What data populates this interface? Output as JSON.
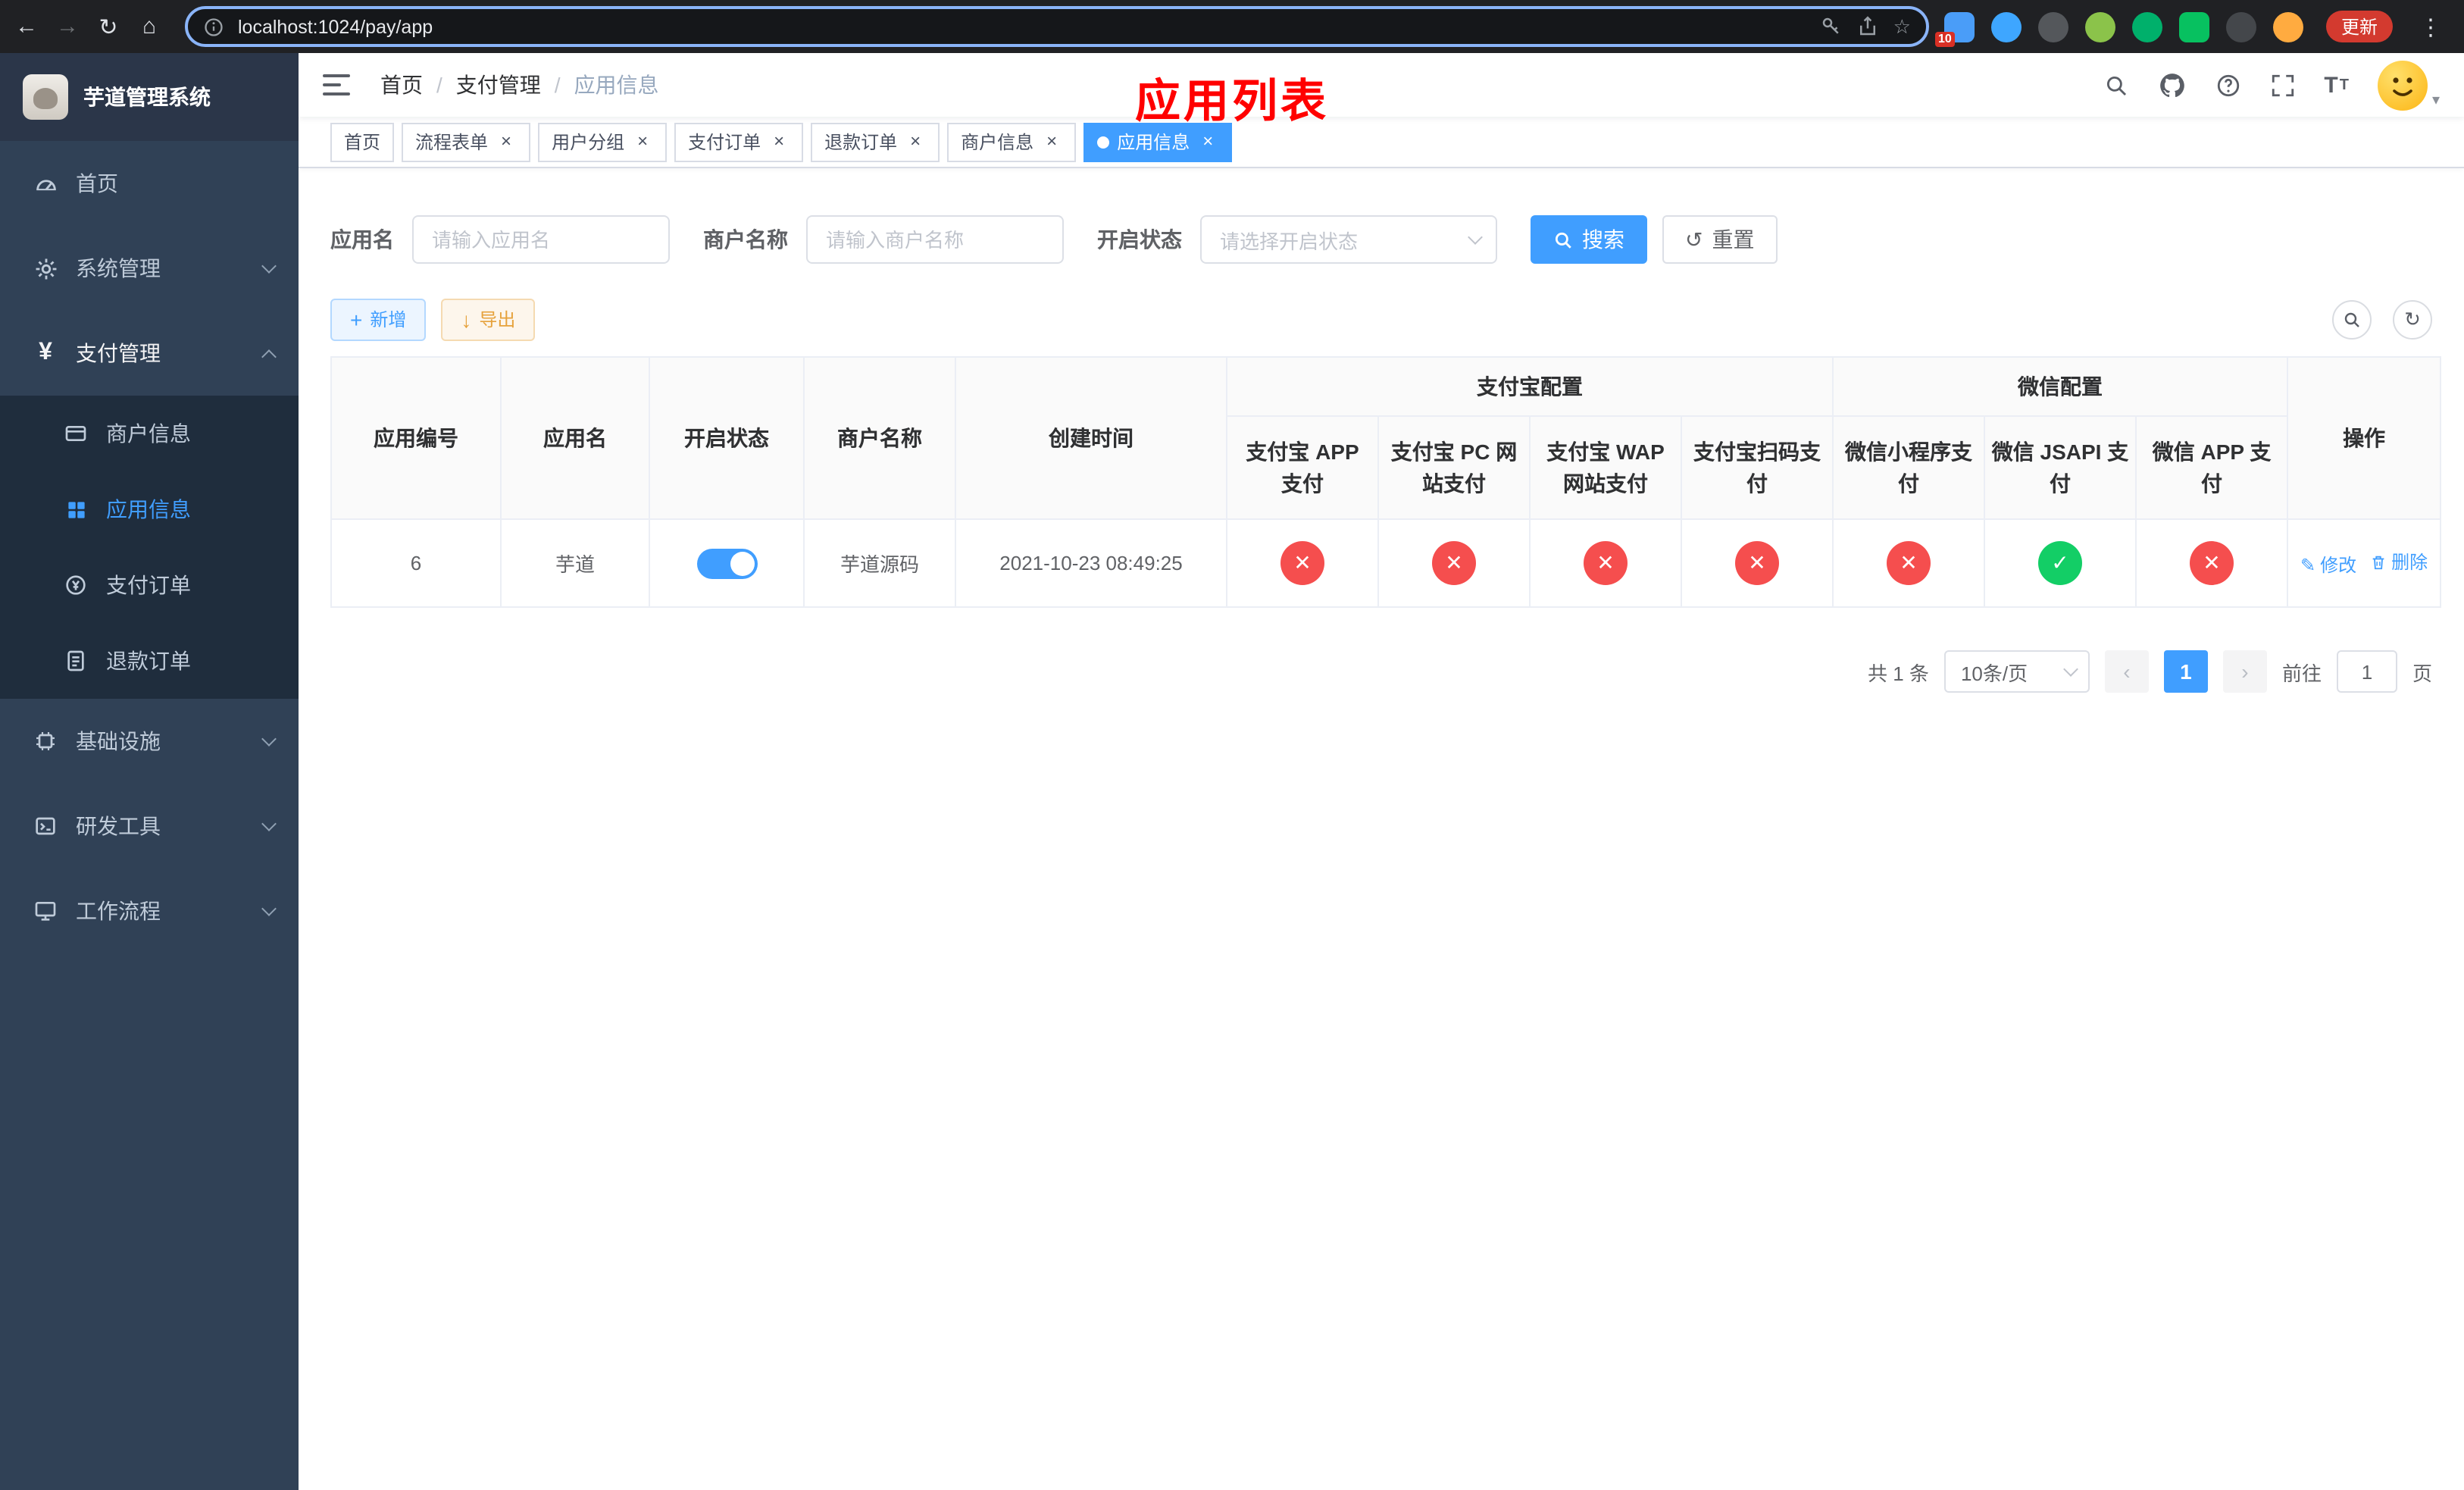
{
  "browser": {
    "url": "localhost:1024/pay/app",
    "update_label": "更新",
    "extension_badge": "10"
  },
  "colors": {
    "primary": "#409eff",
    "banner_red": "#ff0000",
    "success": "#13ce66",
    "danger": "#f54e4e",
    "warning": "#e6a23c",
    "sidebar_bg": "#304156",
    "submenu_bg": "#1f2d3d"
  },
  "icons": {
    "back": "←",
    "forward": "→",
    "reload": "↻",
    "home": "⌂",
    "star": "☆",
    "menu_dots": "⋮",
    "close": "×",
    "check": "✓",
    "cross": "✕",
    "add": "+",
    "export": "↓",
    "reset": "↺",
    "refresh": "↻",
    "edit": "✎",
    "prev": "‹",
    "next": "›",
    "caret_down": "▾"
  },
  "sidebar": {
    "logo_title": "芋道管理系统",
    "items": [
      {
        "label": "首页"
      },
      {
        "label": "系统管理"
      },
      {
        "label": "支付管理"
      },
      {
        "label": "商户信息"
      },
      {
        "label": "应用信息"
      },
      {
        "label": "支付订单"
      },
      {
        "label": "退款订单"
      },
      {
        "label": "基础设施"
      },
      {
        "label": "研发工具"
      },
      {
        "label": "工作流程"
      }
    ]
  },
  "header": {
    "breadcrumb": [
      "首页",
      "支付管理",
      "应用信息"
    ],
    "banner": "应用列表"
  },
  "tabs": [
    {
      "label": "首页"
    },
    {
      "label": "流程表单"
    },
    {
      "label": "用户分组"
    },
    {
      "label": "支付订单"
    },
    {
      "label": "退款订单"
    },
    {
      "label": "商户信息"
    },
    {
      "label": "应用信息"
    }
  ],
  "filters": {
    "app_name_label": "应用名",
    "app_name_placeholder": "请输入应用名",
    "merchant_label": "商户名称",
    "merchant_placeholder": "请输入商户名称",
    "status_label": "开启状态",
    "status_placeholder": "请选择开启状态",
    "search_label": "搜索",
    "reset_label": "重置"
  },
  "toolbar": {
    "add_label": "新增",
    "export_label": "导出"
  },
  "table": {
    "columns": {
      "id": "应用编号",
      "name": "应用名",
      "status": "开启状态",
      "merchant": "商户名称",
      "created": "创建时间",
      "alipay_group": "支付宝配置",
      "wechat_group": "微信配置",
      "alipay_app": "支付宝 APP 支付",
      "alipay_pc": "支付宝 PC 网站支付",
      "alipay_wap": "支付宝 WAP 网站支付",
      "alipay_scan": "支付宝扫码支付",
      "wechat_mini": "微信小程序支付",
      "wechat_jsapi": "微信 JSAPI 支付",
      "wechat_app": "微信 APP 支付",
      "actions": "操作"
    },
    "rows": [
      {
        "id": "6",
        "name": "芋道",
        "enabled": true,
        "merchant": "芋道源码",
        "created": "2021-10-23 08:49:25",
        "configs": [
          false,
          false,
          false,
          false,
          false,
          true,
          false
        ],
        "edit_label": "修改",
        "delete_label": "删除"
      }
    ]
  },
  "pagination": {
    "total_label": "共 1 条",
    "page_size_label": "10条/页",
    "current_page": "1",
    "goto_label": "前往",
    "goto_value": "1",
    "page_unit": "页"
  }
}
